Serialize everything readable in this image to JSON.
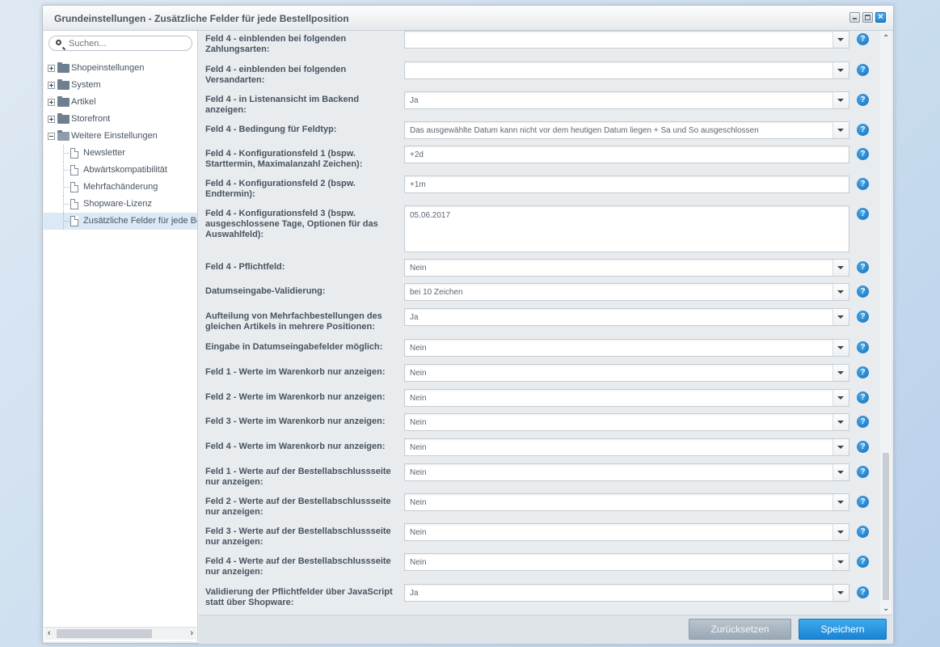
{
  "window": {
    "title": "Grundeinstellungen - Zusätzliche Felder für jede Bestellposition",
    "close_glyph": "×"
  },
  "sidebar": {
    "search_placeholder": "Suchen...",
    "tree": [
      {
        "label": "Shopeinstellungen",
        "type": "folder",
        "expanded": false,
        "level": 0
      },
      {
        "label": "System",
        "type": "folder",
        "expanded": false,
        "level": 0
      },
      {
        "label": "Artikel",
        "type": "folder",
        "expanded": false,
        "level": 0
      },
      {
        "label": "Storefront",
        "type": "folder",
        "expanded": false,
        "level": 0
      },
      {
        "label": "Weitere Einstellungen",
        "type": "folder",
        "expanded": true,
        "level": 0
      },
      {
        "label": "Newsletter",
        "type": "doc",
        "level": 1
      },
      {
        "label": "Abwärtskompatibilität",
        "type": "doc",
        "level": 1
      },
      {
        "label": "Mehrfachänderung",
        "type": "doc",
        "level": 1
      },
      {
        "label": "Shopware-Lizenz",
        "type": "doc",
        "level": 1
      },
      {
        "label": "Zusätzliche Felder für jede Bes",
        "type": "doc",
        "level": 1,
        "selected": true
      }
    ]
  },
  "form": {
    "help_glyph": "?",
    "fields": [
      {
        "label": "Feld 4 - einblenden bei folgenden Zahlungsarten:",
        "value": "",
        "type": "select"
      },
      {
        "label": "Feld 4 - einblenden bei folgenden Versandarten:",
        "value": "",
        "type": "select"
      },
      {
        "label": "Feld 4 - in Listenansicht im Backend anzeigen:",
        "value": "Ja",
        "type": "select"
      },
      {
        "label": "Feld 4 - Bedingung für Feldtyp:",
        "value": "Das ausgewählte Datum kann nicht vor dem heutigen Datum liegen + Sa und So ausgeschlossen",
        "type": "select"
      },
      {
        "label": "Feld 4 - Konfigurationsfeld 1 (bspw. Starttermin, Maximalanzahl Zeichen):",
        "value": "+2d",
        "type": "text"
      },
      {
        "label": "Feld 4 - Konfigurationsfeld 2 (bspw. Endtermin):",
        "value": "+1m",
        "type": "text"
      },
      {
        "label": "Feld 4 - Konfigurationsfeld 3 (bspw. ausgeschlossene Tage, Optionen für das Auswahlfeld):",
        "value": "05.06.2017",
        "type": "textarea"
      },
      {
        "label": "Feld 4 - Pflichtfeld:",
        "value": "Nein",
        "type": "select"
      },
      {
        "label": "Datumseingabe-Validierung:",
        "value": "bei 10 Zeichen",
        "type": "select"
      },
      {
        "label": "Aufteilung von Mehrfachbestellungen des gleichen Artikels in mehrere Positionen:",
        "value": "Ja",
        "type": "select"
      },
      {
        "label": "Eingabe in Datumseingabefelder möglich:",
        "value": "Nein",
        "type": "select"
      },
      {
        "label": "Feld 1 - Werte im Warenkorb nur anzeigen:",
        "value": "Nein",
        "type": "select"
      },
      {
        "label": "Feld 2 - Werte im Warenkorb nur anzeigen:",
        "value": "Nein",
        "type": "select"
      },
      {
        "label": "Feld 3 - Werte im Warenkorb nur anzeigen:",
        "value": "Nein",
        "type": "select"
      },
      {
        "label": "Feld 4 - Werte im Warenkorb nur anzeigen:",
        "value": "Nein",
        "type": "select"
      },
      {
        "label": "Feld 1 - Werte auf der Bestellabschlussseite nur anzeigen:",
        "value": "Nein",
        "type": "select"
      },
      {
        "label": "Feld 2 - Werte auf der Bestellabschlussseite nur anzeigen:",
        "value": "Nein",
        "type": "select"
      },
      {
        "label": "Feld 3 - Werte auf der Bestellabschlussseite nur anzeigen:",
        "value": "Nein",
        "type": "select"
      },
      {
        "label": "Feld 4 - Werte auf der Bestellabschlussseite nur anzeigen:",
        "value": "Nein",
        "type": "select"
      },
      {
        "label": "Validierung der Pflichtfelder über JavaScript statt über Shopware:",
        "value": "Ja",
        "type": "select"
      }
    ]
  },
  "footer": {
    "reset_label": "Zurücksetzen",
    "save_label": "Speichern"
  },
  "colors": {
    "accent": "#1a84d3",
    "help": "#146fb8"
  }
}
